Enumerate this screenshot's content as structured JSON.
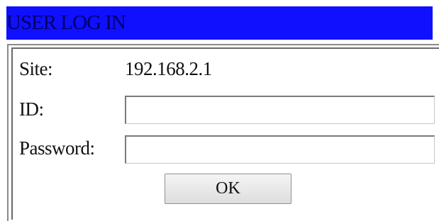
{
  "header": {
    "title": "USER LOG IN",
    "background_color": "#1010ff",
    "text_color": "#00006a"
  },
  "form": {
    "site_label": "Site:",
    "site_value": "192.168.2.1",
    "id_label": "ID:",
    "id_value": "",
    "password_label": "Password:",
    "password_value": "",
    "ok_label": "OK"
  }
}
